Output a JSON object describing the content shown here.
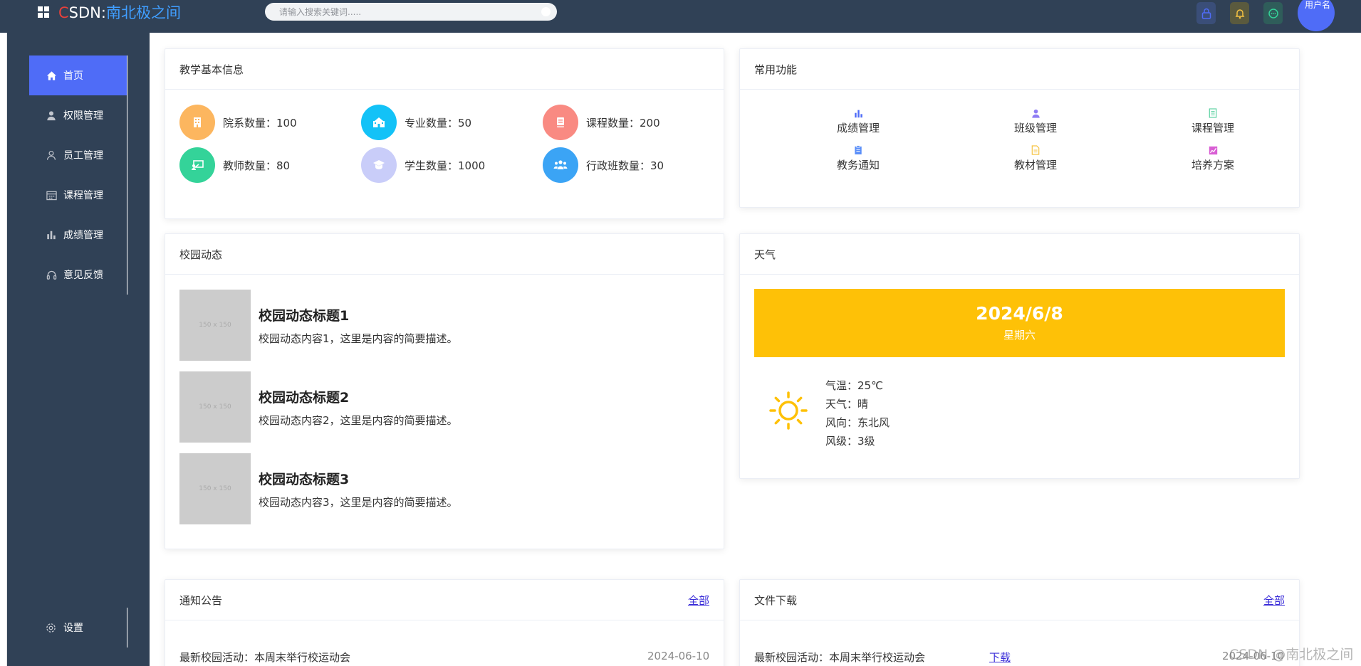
{
  "header": {
    "brand_c": "C",
    "brand_sdn": "SDN:",
    "brand_name": "南北极之间",
    "search_placeholder": "请输入搜索关键词.....",
    "avatar_label": "用户名"
  },
  "sidebar": {
    "items": [
      {
        "label": "首页",
        "icon": "home-icon",
        "active": true
      },
      {
        "label": "权限管理",
        "icon": "user-icon"
      },
      {
        "label": "员工管理",
        "icon": "user-outline-icon"
      },
      {
        "label": "课程管理",
        "icon": "calendar-icon"
      },
      {
        "label": "成绩管理",
        "icon": "bar-chart-icon"
      },
      {
        "label": "意见反馈",
        "icon": "headset-icon"
      }
    ],
    "settings_label": "设置"
  },
  "basic_info": {
    "title": "教学基本信息",
    "stats": [
      {
        "label": "院系数量：100",
        "color": "#fcb65f"
      },
      {
        "label": "专业数量：50",
        "color": "#13c2f7"
      },
      {
        "label": "课程数量：200",
        "color": "#f98a82"
      },
      {
        "label": "教师数量：80",
        "color": "#34d399"
      },
      {
        "label": "学生数量：1000",
        "color": "#c9cdf9"
      },
      {
        "label": "行政班数量：30",
        "color": "#3ba4f5"
      }
    ]
  },
  "functions": {
    "title": "常用功能",
    "items": [
      {
        "label": "成绩管理",
        "icon": "bar-chart-icon",
        "color": "#4f6cf7"
      },
      {
        "label": "班级管理",
        "icon": "user-icon",
        "color": "#8e7cf4"
      },
      {
        "label": "课程管理",
        "icon": "book-icon",
        "color": "#5fd3a4"
      },
      {
        "label": "教务通知",
        "icon": "clipboard-icon",
        "color": "#5b8ff9"
      },
      {
        "label": "教材管理",
        "icon": "document-icon",
        "color": "#f6c342"
      },
      {
        "label": "培养方案",
        "icon": "trend-icon",
        "color": "#d95fd4"
      }
    ]
  },
  "campus": {
    "title": "校园动态",
    "thumb_label": "150 x 150",
    "items": [
      {
        "title": "校园动态标题1",
        "desc": "校园动态内容1，这里是内容的简要描述。"
      },
      {
        "title": "校园动态标题2",
        "desc": "校园动态内容2，这里是内容的简要描述。"
      },
      {
        "title": "校园动态标题3",
        "desc": "校园动态内容3，这里是内容的简要描述。"
      }
    ]
  },
  "weather": {
    "title": "天气",
    "date": "2024/6/8",
    "weekday": "星期六",
    "lines": [
      "气温：25℃",
      "天气：晴",
      "风向：东北风",
      "风级：3级"
    ],
    "banner_color": "#fec107"
  },
  "notices": {
    "title": "通知公告",
    "more": "全部",
    "rows": [
      {
        "text": "最新校园活动：本周末举行校运动会",
        "date": "2024-06-10"
      }
    ]
  },
  "files": {
    "title": "文件下载",
    "more": "全部",
    "rows": [
      {
        "text": "最新校园活动：本周末举行校运动会",
        "action": "下载",
        "date": "2024-06-10"
      }
    ]
  },
  "watermark": "CSDN @南北极之间"
}
